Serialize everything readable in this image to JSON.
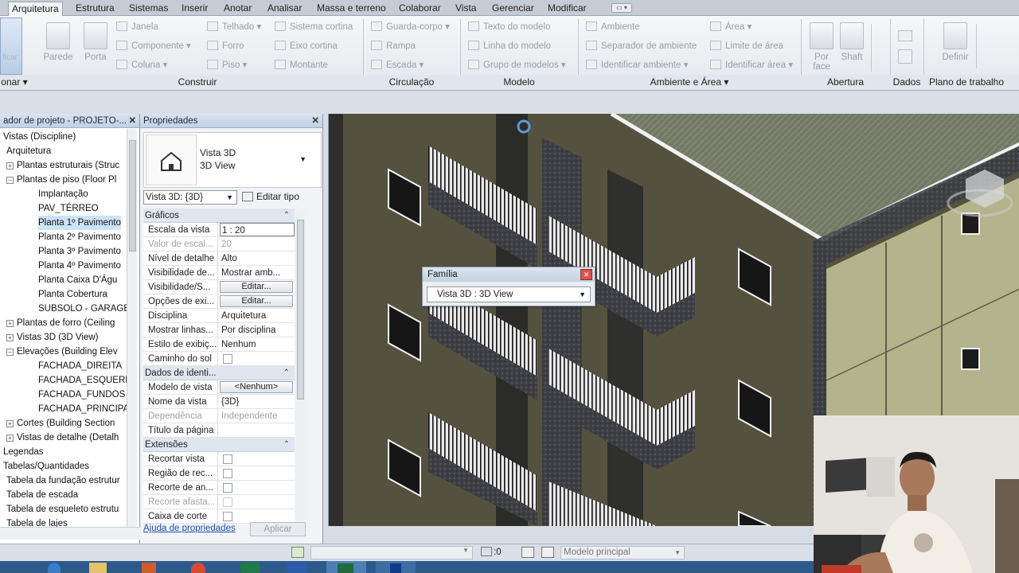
{
  "ribbon": {
    "tabs": [
      "Arquitetura",
      "Estrutura",
      "Sistemas",
      "Inserir",
      "Anotar",
      "Analisar",
      "Massa e terreno",
      "Colaborar",
      "Vista",
      "Gerenciar",
      "Modificar"
    ],
    "active_tab": "Arquitetura",
    "construir": {
      "parede": "Parede",
      "porta": "Porta",
      "janela": "Janela",
      "componente": "Componente",
      "coluna": "Coluna",
      "telhado": "Telhado",
      "forro": "Forro",
      "piso": "Piso",
      "sistema_cortina": "Sistema cortina",
      "eixo_cortina": "Eixo cortina",
      "montante": "Montante"
    },
    "circulacao": {
      "guarda_corpo": "Guarda-corpo",
      "rampa": "Rampa",
      "escada": "Escada"
    },
    "modelo": {
      "texto": "Texto do modelo",
      "linha": "Linha do modelo",
      "grupo": "Grupo de modelos"
    },
    "ambiente": {
      "ambiente": "Ambiente",
      "separador": "Separador de ambiente",
      "identificar": "Identificar ambiente",
      "area": "Área",
      "limite": "Limite de área",
      "identificar_area": "Identificar área"
    },
    "abertura": {
      "por_face": "Por face",
      "shaft": "Shaft"
    },
    "plano": {
      "definir": "Definir"
    },
    "groups": {
      "selecionar": "onar",
      "construir": "Construir",
      "circulacao": "Circulação",
      "modelo": "Modelo",
      "ambiente": "Ambiente e Área",
      "abertura": "Abertura",
      "dados": "Dados",
      "plano": "Plano de trabalho"
    },
    "modify_stub": "ficar"
  },
  "browser": {
    "title": "ador de projeto - PROJETO-...",
    "items": [
      {
        "label": "Vistas (Discipline)",
        "indent": 0,
        "pm": ""
      },
      {
        "label": "Arquitetura",
        "indent": 1,
        "pm": ""
      },
      {
        "label": "Plantas estruturais (Struc",
        "indent": 2,
        "pm": "+"
      },
      {
        "label": "Plantas de piso (Floor Pl",
        "indent": 2,
        "pm": "-"
      },
      {
        "label": "Implantação",
        "indent": 3,
        "pm": ""
      },
      {
        "label": "PAV_TÉRREO",
        "indent": 3,
        "pm": ""
      },
      {
        "label": "Planta 1º Pavimento",
        "indent": 3,
        "pm": "",
        "sel": true
      },
      {
        "label": "Planta 2º Pavimento",
        "indent": 3,
        "pm": ""
      },
      {
        "label": "Planta 3º Pavimento",
        "indent": 3,
        "pm": ""
      },
      {
        "label": "Planta 4º Pavimento",
        "indent": 3,
        "pm": ""
      },
      {
        "label": "Planta Caixa D'Águ",
        "indent": 3,
        "pm": ""
      },
      {
        "label": "Planta Cobertura",
        "indent": 3,
        "pm": ""
      },
      {
        "label": "SUBSOLO - GARAGE",
        "indent": 3,
        "pm": ""
      },
      {
        "label": "Plantas de forro (Ceiling",
        "indent": 2,
        "pm": "+"
      },
      {
        "label": "Vistas 3D (3D View)",
        "indent": 2,
        "pm": "+"
      },
      {
        "label": "Elevações (Building Elev",
        "indent": 2,
        "pm": "-"
      },
      {
        "label": "FACHADA_DIREITA",
        "indent": 3,
        "pm": ""
      },
      {
        "label": "FACHADA_ESQUERD",
        "indent": 3,
        "pm": ""
      },
      {
        "label": "FACHADA_FUNDOS",
        "indent": 3,
        "pm": ""
      },
      {
        "label": "FACHADA_PRINCIPA",
        "indent": 3,
        "pm": ""
      },
      {
        "label": "Cortes (Building Section",
        "indent": 2,
        "pm": "+"
      },
      {
        "label": "Vistas de detalhe (Detalh",
        "indent": 2,
        "pm": "+"
      },
      {
        "label": "Legendas",
        "indent": 0,
        "pm": ""
      },
      {
        "label": "Tabelas/Quantidades",
        "indent": 0,
        "pm": ""
      },
      {
        "label": "Tabela da fundação estrutur",
        "indent": 1,
        "pm": ""
      },
      {
        "label": "Tabela de escada",
        "indent": 1,
        "pm": ""
      },
      {
        "label": "Tabela de esqueleto estrutu",
        "indent": 1,
        "pm": ""
      },
      {
        "label": "Tabela de lajes",
        "indent": 1,
        "pm": ""
      }
    ]
  },
  "props": {
    "title": "Propriedades",
    "type_line1": "Vista 3D",
    "type_line2": "3D View",
    "view_select": "Vista 3D: {3D}",
    "edit_type": "Editar tipo",
    "sections": {
      "graficos": "Gráficos",
      "identidade": "Dados de identi...",
      "extensoes": "Extensões"
    },
    "rows_graficos": [
      {
        "k": "Escala da vista",
        "v": "1 : 20",
        "kind": "input"
      },
      {
        "k": "Valor de escal...",
        "v": "20",
        "kind": "dis"
      },
      {
        "k": "Nível de detalhe",
        "v": "Alto"
      },
      {
        "k": "Visibilidade de...",
        "v": "Mostrar amb..."
      },
      {
        "k": "Visibilidade/S...",
        "v": "Editar...",
        "kind": "btn"
      },
      {
        "k": "Opções de exi...",
        "v": "Editar...",
        "kind": "btn"
      },
      {
        "k": "Disciplina",
        "v": "Arquitetura"
      },
      {
        "k": "Mostrar linhas...",
        "v": "Por disciplina"
      },
      {
        "k": "Estilo de exibiç...",
        "v": "Nenhum"
      },
      {
        "k": "Caminho do sol",
        "v": "",
        "kind": "chk"
      }
    ],
    "rows_identidade": [
      {
        "k": "Modelo de vista",
        "v": "<Nenhum>",
        "kind": "btn"
      },
      {
        "k": "Nome da vista",
        "v": "{3D}"
      },
      {
        "k": "Dependência",
        "v": "Independente",
        "kind": "dis"
      },
      {
        "k": "Título da página",
        "v": ""
      }
    ],
    "rows_extensoes": [
      {
        "k": "Recortar vista",
        "v": "",
        "kind": "chk"
      },
      {
        "k": "Região de rec...",
        "v": "",
        "kind": "chk"
      },
      {
        "k": "Recorte de an...",
        "v": "",
        "kind": "chk"
      },
      {
        "k": "Recorte afasta...",
        "v": "",
        "kind": "chkdis"
      },
      {
        "k": "Caixa de corte",
        "v": "",
        "kind": "chk"
      }
    ],
    "help_link": "Ajuda de propriedades",
    "apply": "Aplicar"
  },
  "family_dialog": {
    "title": "Família",
    "value": "Vista 3D : 3D View"
  },
  "status": {
    "zero": ":0",
    "model": "Modelo principal"
  },
  "colors": {
    "ribbon_bg": "#eef1f4",
    "panel_title": "#c9d5e6",
    "wall": "#5a5847",
    "brick": "#3c3e42",
    "roof": "#6f7663",
    "selection": "#cde3f7"
  }
}
